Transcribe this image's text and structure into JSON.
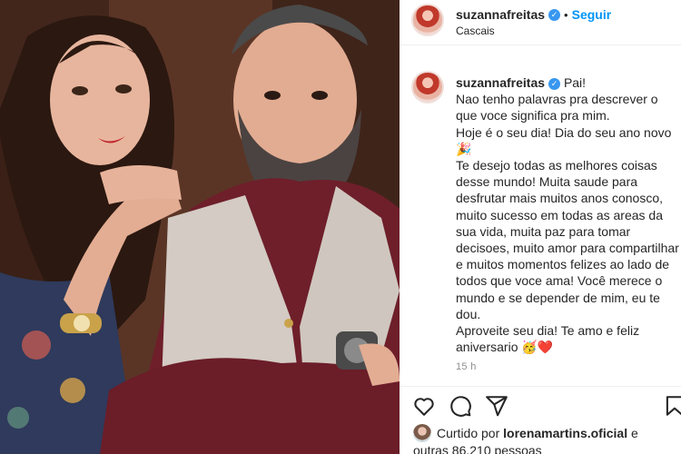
{
  "post": {
    "username": "suzannafreitas",
    "verified_glyph": "✓",
    "separator": "•",
    "follow_label": "Seguir",
    "location": "Cascais"
  },
  "caption": {
    "username": "suzannafreitas",
    "text": "Pai!\nNao tenho palavras pra descrever o que voce significa pra mim.\nHoje é o seu dia! Dia do seu ano novo 🎉\nTe desejo todas as melhores coisas desse mundo! Muita saude para desfrutar mais muitos anos conosco, muito sucesso em todas as areas da sua vida, muita paz para tomar decisoes, muito amor para compartilhar e muitos momentos felizes ao lado de todos que voce ama! Você merece o mundo e se depender de mim, eu te dou.\nAproveite seu dia! Te amo e feliz aniversario 🥳❤️",
    "time_ago": "15 h"
  },
  "actions": {
    "like_icon": "heart-icon",
    "comment_icon": "comment-icon",
    "share_icon": "share-icon",
    "save_icon": "bookmark-icon"
  },
  "likes": {
    "prefix": "Curtido por",
    "liked_by": "lorenamartins.oficial",
    "connector": "e",
    "others": "outras 86.210 pessoas"
  },
  "colors": {
    "link": "#0095f6",
    "verified": "#3897f0",
    "muted": "#8e8e8e",
    "text": "#262626"
  }
}
